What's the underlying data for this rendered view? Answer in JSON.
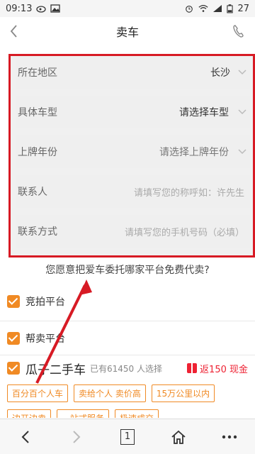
{
  "status": {
    "time": "09:13",
    "battery": "27"
  },
  "header": {
    "title": "卖车"
  },
  "form": {
    "rows": [
      {
        "label": "所在地区",
        "value": "长沙"
      },
      {
        "label": "具体车型",
        "value": "请选择车型"
      },
      {
        "label": "上牌年份",
        "value": "请选择上牌年份"
      },
      {
        "label": "联系人",
        "placeholder": "请填写您的称呼如：许先生"
      },
      {
        "label": "联系方式",
        "placeholder": "请填写您的手机号码（必填）"
      }
    ]
  },
  "question": "您愿意把爱车委托哪家平台免费代卖?",
  "options": [
    {
      "label": "竞拍平台"
    },
    {
      "label": "帮卖平台"
    }
  ],
  "guazi": {
    "name": "瓜子二手车",
    "sub": "已有61450 人选择",
    "bonus": "返150 现金"
  },
  "tags_row1": [
    "百分百个人车",
    "卖给个人 卖价高",
    "15万公里以内"
  ],
  "tags_row2": [
    "边开边卖",
    "一站式服务",
    "极速成交"
  ],
  "nav": {
    "tab_count": "1"
  },
  "colors": {
    "accent": "#f08a24",
    "highlight": "#d71a24"
  }
}
